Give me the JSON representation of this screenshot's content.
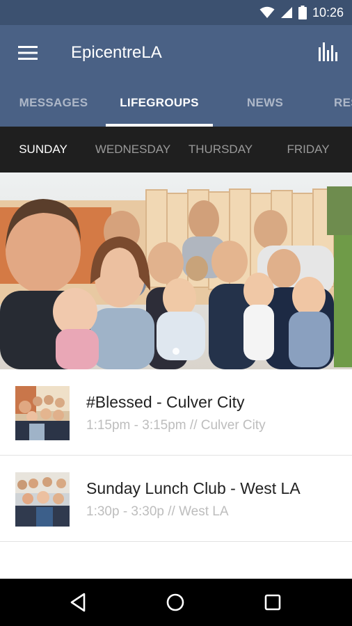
{
  "status": {
    "time": "10:26"
  },
  "app": {
    "title": "EpicentreLA"
  },
  "tabs": [
    {
      "label": "MESSAGES"
    },
    {
      "label": "LIFEGROUPS"
    },
    {
      "label": "NEWS"
    },
    {
      "label": "RES"
    }
  ],
  "days": [
    {
      "label": "SUNDAY"
    },
    {
      "label": "WEDNESDAY"
    },
    {
      "label": "THURSDAY"
    },
    {
      "label": "FRIDAY"
    }
  ],
  "groups": [
    {
      "title": "#Blessed - Culver City",
      "subtitle": "1:15pm - 3:15pm // Culver City"
    },
    {
      "title": "Sunday Lunch Club - West LA",
      "subtitle": "1:30p - 3:30p // West LA"
    }
  ],
  "colors": {
    "appbar": "#4a6185",
    "statusbar": "#3c5170",
    "daybar": "#1f1f1f"
  },
  "icons": [
    "wifi-icon",
    "signal-icon",
    "battery-icon",
    "menu-icon",
    "bar-chart-icon",
    "back-icon",
    "home-icon",
    "recents-icon"
  ]
}
